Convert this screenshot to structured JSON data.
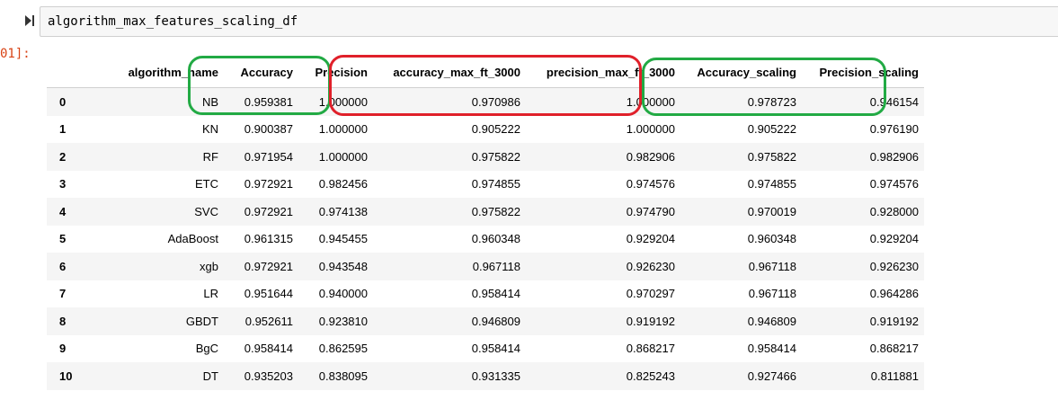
{
  "input_cell": {
    "code": "algorithm_max_features_scaling_df"
  },
  "output_cell": {
    "prompt": "01]:"
  },
  "table": {
    "columns": [
      "algorithm_name",
      "Accuracy",
      "Precision",
      "accuracy_max_ft_3000",
      "precision_max_ft_3000",
      "Accuracy_scaling",
      "Precision_scaling"
    ],
    "rows": [
      {
        "index": "0",
        "cells": [
          "NB",
          "0.959381",
          "1.000000",
          "0.970986",
          "1.000000",
          "0.978723",
          "0.946154"
        ]
      },
      {
        "index": "1",
        "cells": [
          "KN",
          "0.900387",
          "1.000000",
          "0.905222",
          "1.000000",
          "0.905222",
          "0.976190"
        ]
      },
      {
        "index": "2",
        "cells": [
          "RF",
          "0.971954",
          "1.000000",
          "0.975822",
          "0.982906",
          "0.975822",
          "0.982906"
        ]
      },
      {
        "index": "3",
        "cells": [
          "ETC",
          "0.972921",
          "0.982456",
          "0.974855",
          "0.974576",
          "0.974855",
          "0.974576"
        ]
      },
      {
        "index": "4",
        "cells": [
          "SVC",
          "0.972921",
          "0.974138",
          "0.975822",
          "0.974790",
          "0.970019",
          "0.928000"
        ]
      },
      {
        "index": "5",
        "cells": [
          "AdaBoost",
          "0.961315",
          "0.945455",
          "0.960348",
          "0.929204",
          "0.960348",
          "0.929204"
        ]
      },
      {
        "index": "6",
        "cells": [
          "xgb",
          "0.972921",
          "0.943548",
          "0.967118",
          "0.926230",
          "0.967118",
          "0.926230"
        ]
      },
      {
        "index": "7",
        "cells": [
          "LR",
          "0.951644",
          "0.940000",
          "0.958414",
          "0.970297",
          "0.967118",
          "0.964286"
        ]
      },
      {
        "index": "8",
        "cells": [
          "GBDT",
          "0.952611",
          "0.923810",
          "0.946809",
          "0.919192",
          "0.946809",
          "0.919192"
        ]
      },
      {
        "index": "9",
        "cells": [
          "BgC",
          "0.958414",
          "0.862595",
          "0.958414",
          "0.868217",
          "0.958414",
          "0.868217"
        ]
      },
      {
        "index": "10",
        "cells": [
          "DT",
          "0.935203",
          "0.838095",
          "0.931335",
          "0.825243",
          "0.927466",
          "0.811881"
        ]
      }
    ]
  },
  "annotations": {
    "green_color": "#22aa44",
    "red_color": "#e0202a"
  },
  "icons": {
    "run": "run-step-icon"
  }
}
